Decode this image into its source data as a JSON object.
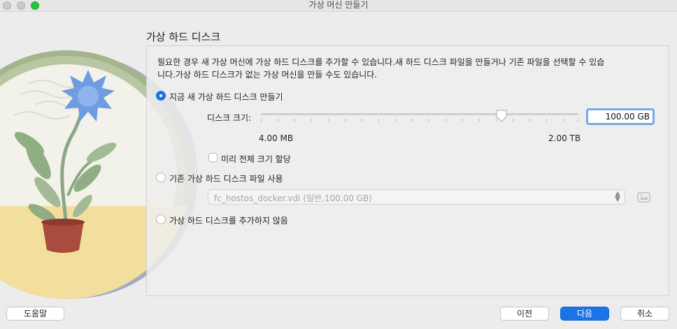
{
  "window": {
    "title": "가상 머신 만들기"
  },
  "page": {
    "heading": "가상 하드 디스크",
    "description": "필요한 경우 새 가상 머신에 가상 하드 디스크를 추가할 수 있습니다.새 하드 디스크 파일을 만들거나 기존 파일을 선택할 수 있습니다.가상 하드 디스크가 없는 가상 머신을 만들 수도 있습니다."
  },
  "options": {
    "create_new": {
      "label": "지금 새 가상 하드 디스크 만들기",
      "selected": true
    },
    "use_existing": {
      "label": "기존 가상 하드 디스크 파일 사용",
      "selected": false
    },
    "no_disk": {
      "label": "가상 하드 디스크를 추가하지 않음",
      "selected": false
    }
  },
  "disk_size": {
    "label": "디스크 크기:",
    "value": "100.00 GB",
    "min_label": "4.00 MB",
    "max_label": "2.00 TB",
    "slider_fraction": 0.76
  },
  "preallocate": {
    "label": "미리 전체 크기 할당",
    "checked": false
  },
  "existing_file": {
    "selected": "fc_hostos_docker.vdi (일반,100.00 GB)"
  },
  "buttons": {
    "help": "도움말",
    "back": "이전",
    "next": "다음",
    "cancel": "취소"
  },
  "colors": {
    "accent": "#1a74e8"
  }
}
